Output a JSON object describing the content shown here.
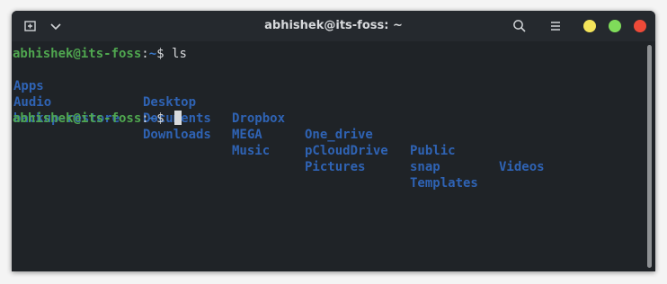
{
  "window": {
    "title": "abhishek@its-foss: ~"
  },
  "titlebar": {
    "icons": [
      "new-tab-icon",
      "chevron-down-icon",
      "search-icon",
      "hamburger-menu-icon"
    ],
    "window_controls": {
      "minimize_color": "#f4e45a",
      "maximize_color": "#7fdc5a",
      "close_color": "#ee4a38"
    }
  },
  "terminal": {
    "prompt_user": "abhishek@its-foss",
    "prompt_sep": ":",
    "prompt_path": "~",
    "prompt_symbol": "$",
    "command": "ls",
    "ls_rows": [
      [
        "Apps",
        "Desktop",
        "Dropbox",
        "One_drive",
        "Public",
        "Videos"
      ],
      [
        "Audio",
        "Documents",
        "MEGA",
        "pCloudDrive",
        "snap",
        ""
      ],
      [
        "backup-restore",
        "Downloads",
        "Music",
        "Pictures",
        "Templates",
        ""
      ]
    ],
    "colors": {
      "background": "#1f2327",
      "user": "#4fa64f",
      "directory": "#2f63b4",
      "text": "#d8dadd"
    }
  }
}
